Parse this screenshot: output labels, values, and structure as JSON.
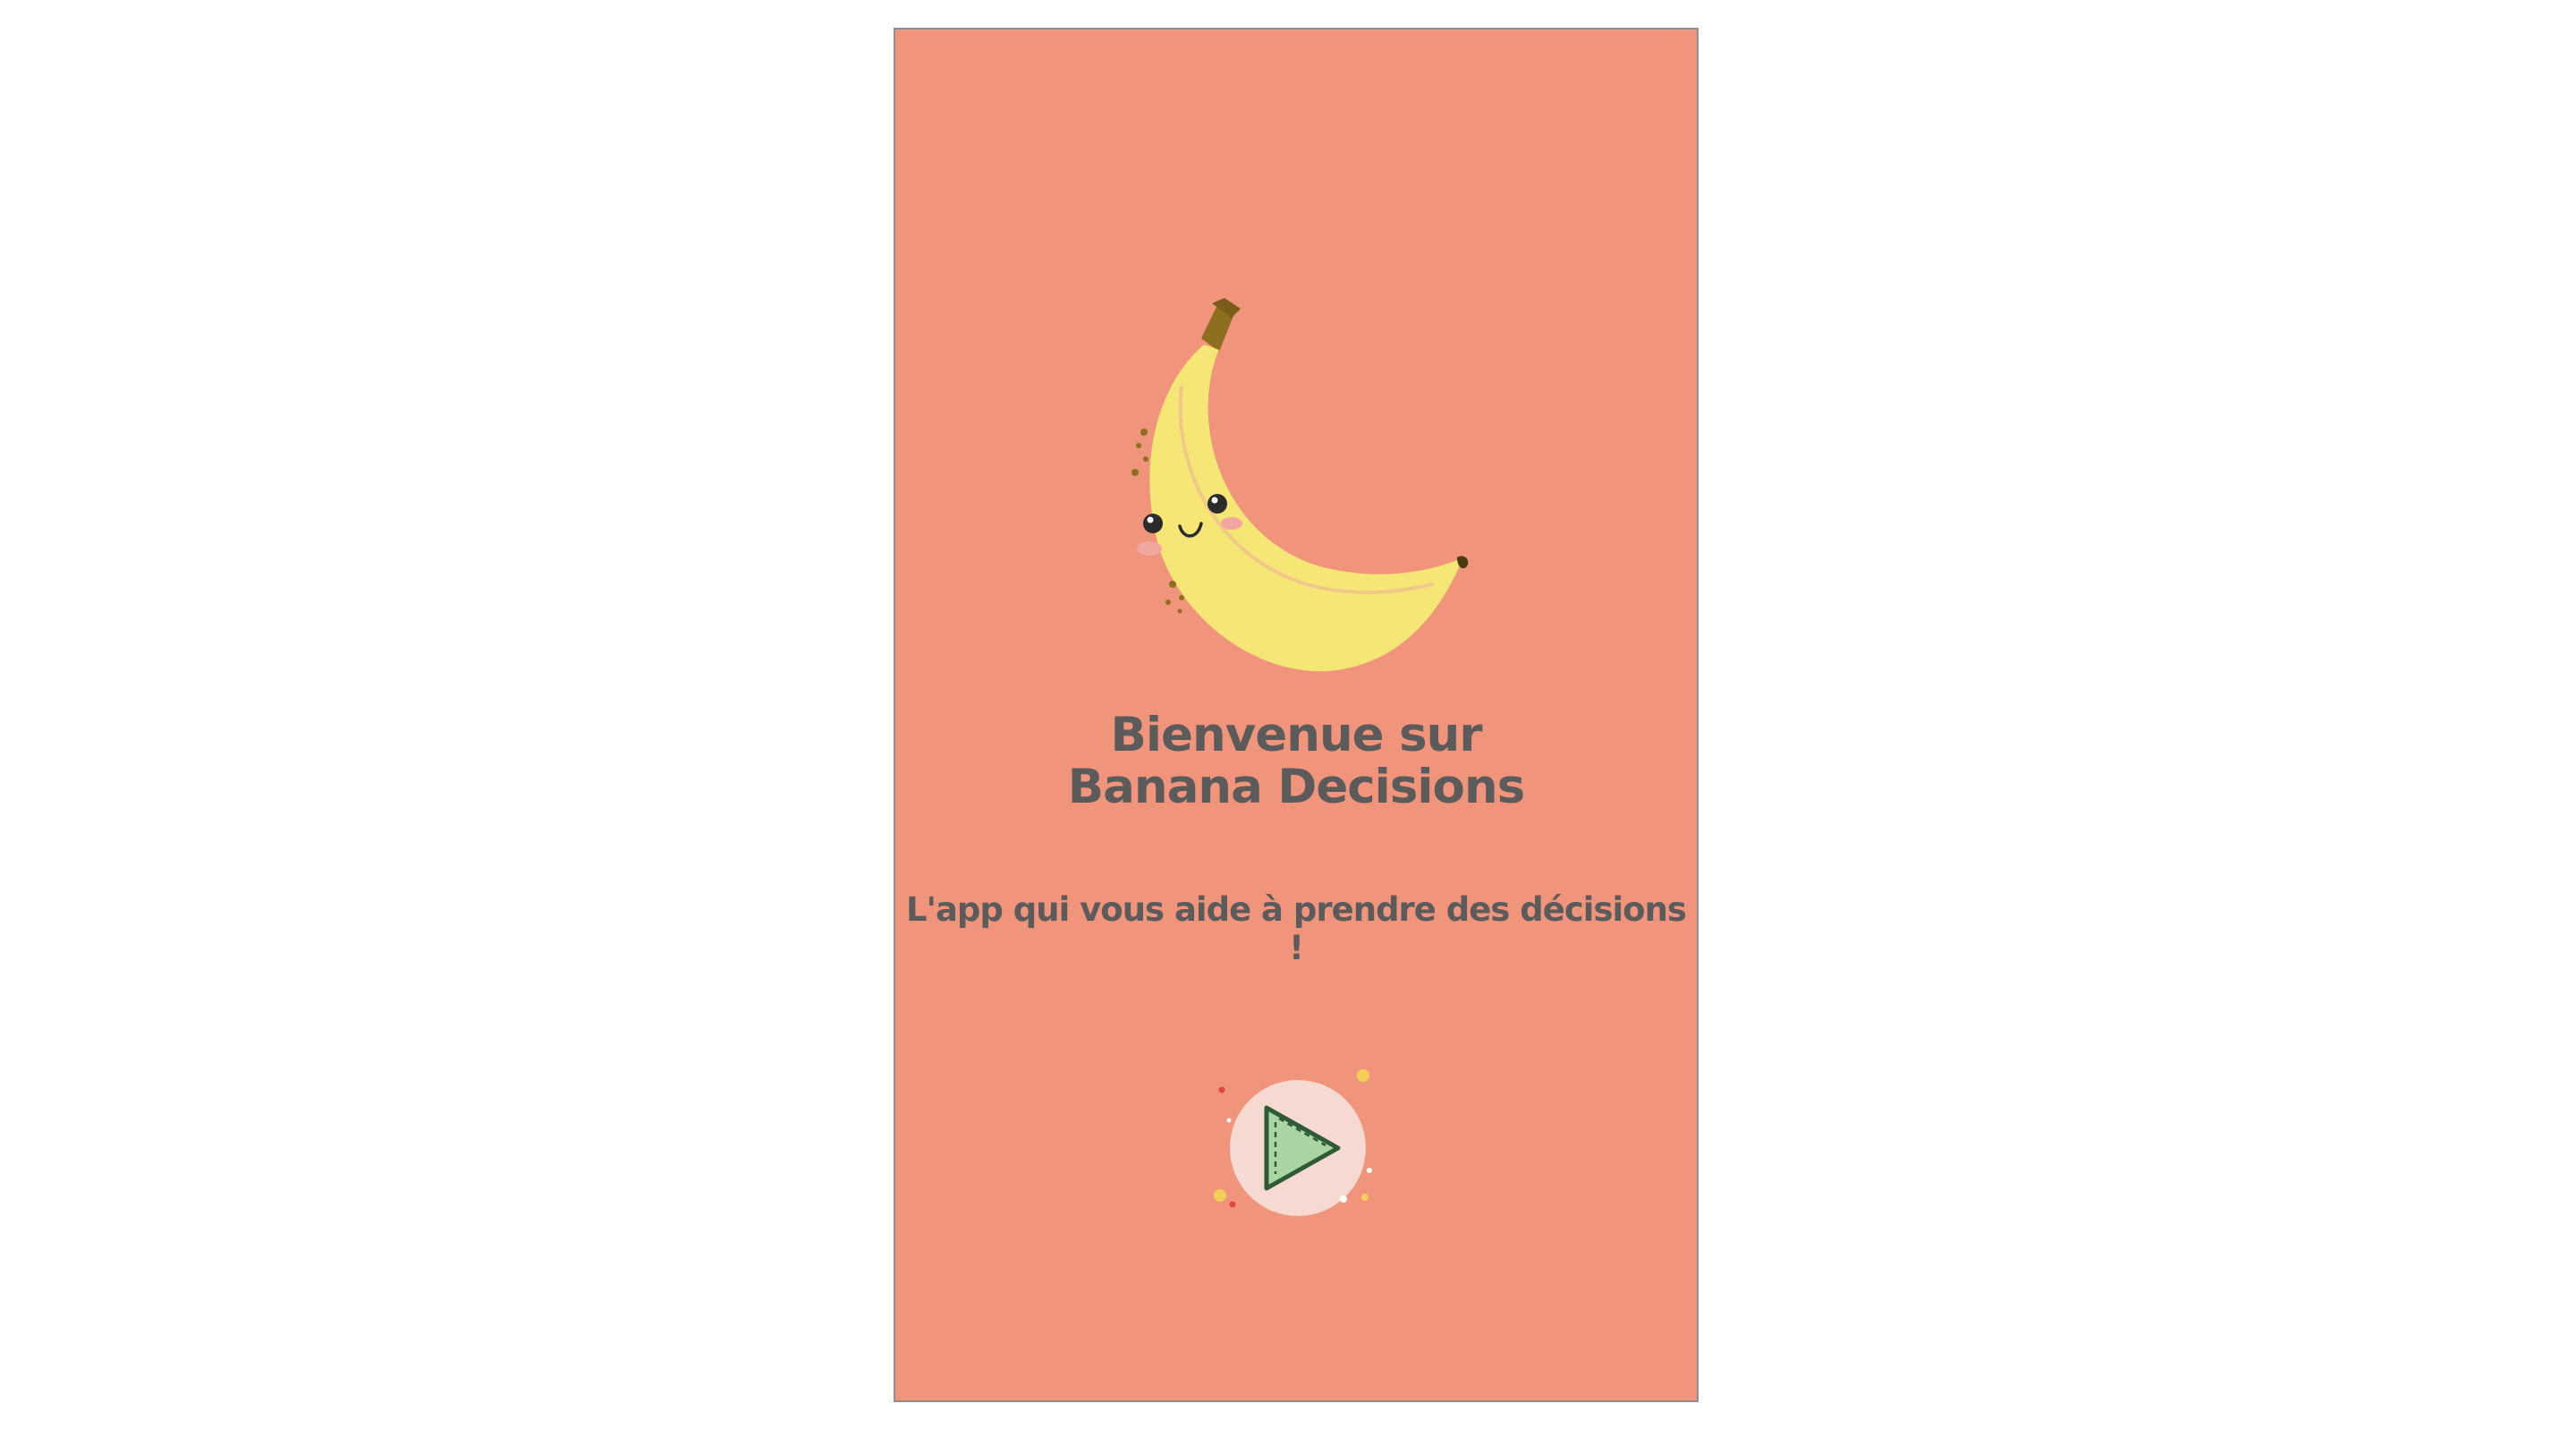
{
  "welcome": {
    "title_line1": "Bienvenue sur",
    "title_line2": "Banana Decisions",
    "subtitle": "L'app qui vous aide à prendre des décisions !"
  },
  "icons": {
    "mascot": "banana-mascot-icon",
    "start": "play-icon"
  },
  "colors": {
    "screen_background": "#f0947c",
    "text": "#5b5b5b",
    "banana_yellow": "#f6e676",
    "play_circle": "#f6d9d1",
    "play_triangle": "#a9d4a4",
    "play_outline": "#2f5a36"
  }
}
